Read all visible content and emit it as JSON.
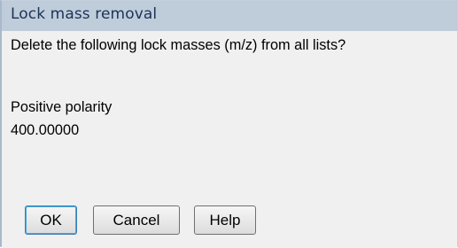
{
  "dialog": {
    "title": "Lock mass removal",
    "question": "Delete the following lock masses (m/z) from all lists?",
    "polarity": "Positive polarity",
    "mass": "400.00000"
  },
  "buttons": {
    "ok": "OK",
    "cancel": "Cancel",
    "help": "Help"
  }
}
